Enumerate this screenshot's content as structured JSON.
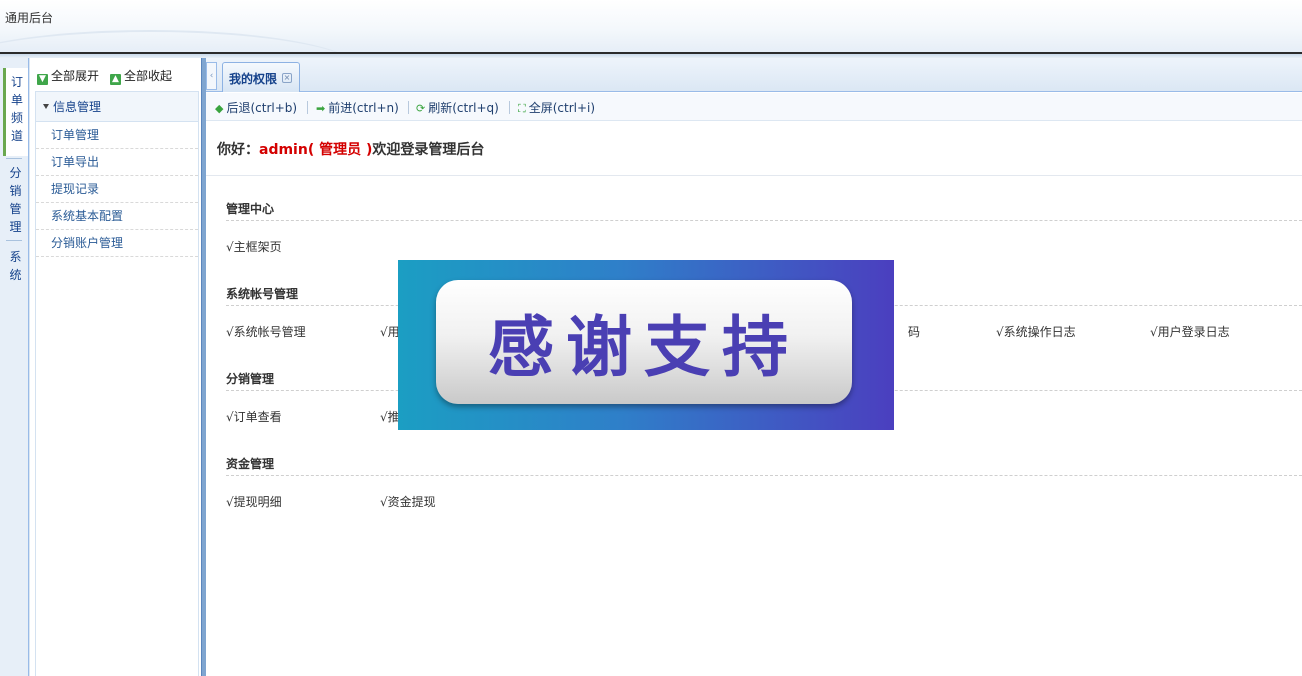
{
  "app": {
    "title": "通用后台"
  },
  "channels": [
    {
      "label": "订单频道",
      "active": true
    },
    {
      "label": "分销管理",
      "active": false
    },
    {
      "label": "系统",
      "active": false
    }
  ],
  "leftnav": {
    "expand_all": "全部展开",
    "collapse_all": "全部收起",
    "group_title": "信息管理",
    "items": [
      "订单管理",
      "订单导出",
      "提现记录",
      "系统基本配置",
      "分销账户管理"
    ]
  },
  "tabs": [
    {
      "label": "我的权限"
    }
  ],
  "toolbar": {
    "back": "后退(ctrl+b)",
    "forward": "前进(ctrl+n)",
    "refresh": "刷新(ctrl+q)",
    "fullscreen": "全屏(ctrl+i)"
  },
  "greeting": {
    "prefix": "你好：",
    "user": "admin( 管理员 )",
    "suffix": "欢迎登录管理后台"
  },
  "sections": [
    {
      "title": "管理中心",
      "items": [
        "√主框架页"
      ]
    },
    {
      "title": "系统帐号管理",
      "items": [
        "√系统帐号管理",
        "√用",
        "码",
        "√系统操作日志",
        "√用户登录日志"
      ]
    },
    {
      "title": "分销管理",
      "items": [
        "√订单查看",
        "√推"
      ]
    },
    {
      "title": "资金管理",
      "items": [
        "√提现明细",
        "√资金提现"
      ]
    }
  ],
  "overlay": {
    "text": "感谢支持"
  },
  "colors": {
    "accent": "#15428b",
    "highlight": "#d40000",
    "splitter": "#7fa5d0"
  }
}
